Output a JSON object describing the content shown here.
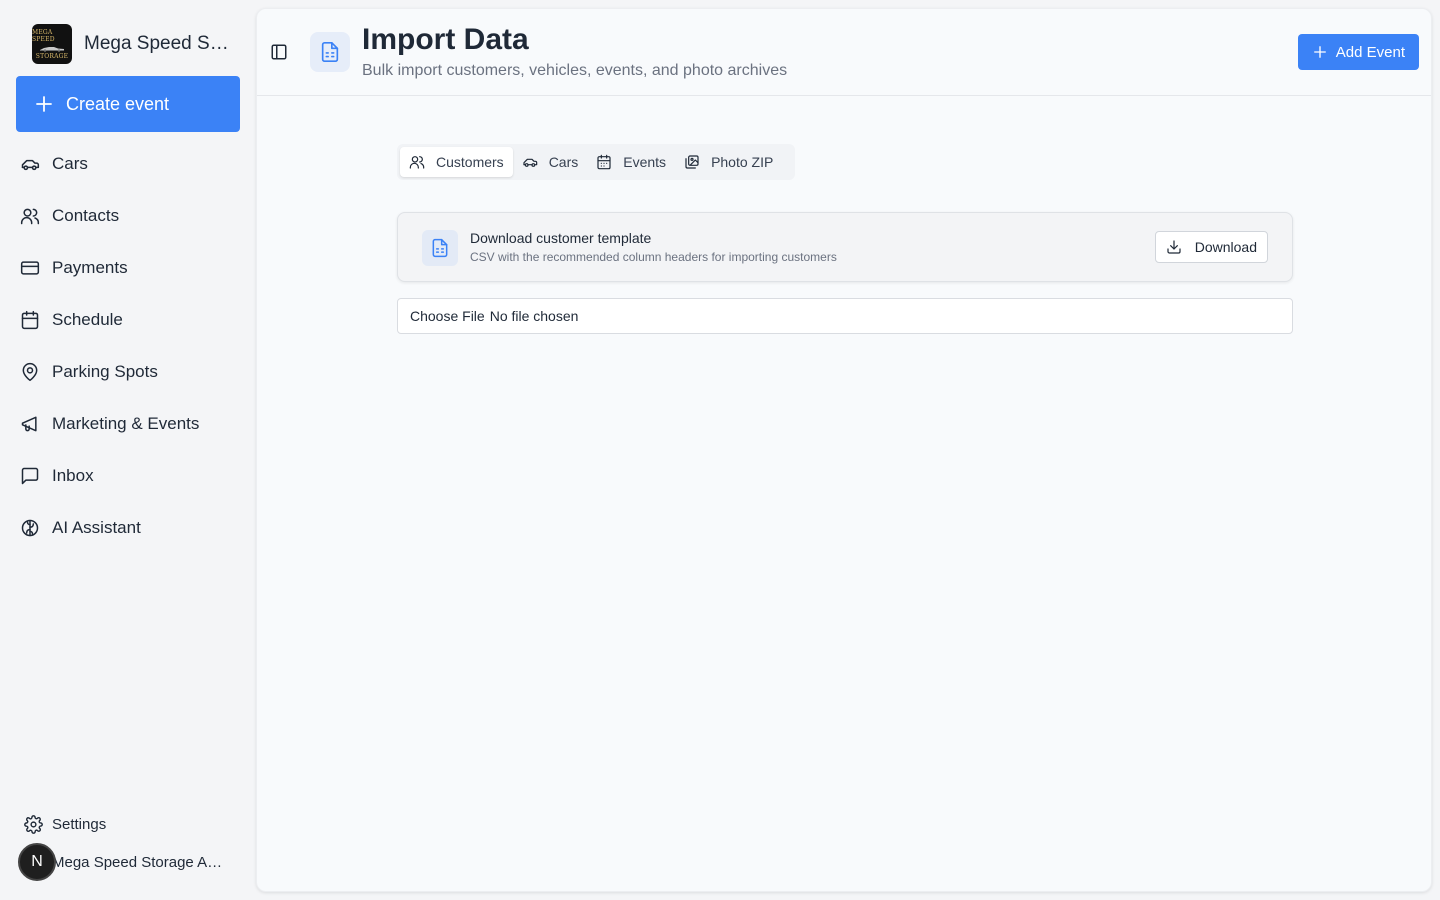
{
  "sidebar": {
    "brand": {
      "name": "Mega Speed Storage",
      "logo_top": "MEGA SPEED",
      "logo_bottom": "STORAGE"
    },
    "create_button": "Create event",
    "items": [
      {
        "label": "Cars",
        "icon": "car-icon"
      },
      {
        "label": "Contacts",
        "icon": "users-icon"
      },
      {
        "label": "Payments",
        "icon": "credit-card-icon"
      },
      {
        "label": "Schedule",
        "icon": "calendar-icon"
      },
      {
        "label": "Parking Spots",
        "icon": "map-pin-icon"
      },
      {
        "label": "Marketing & Events",
        "icon": "megaphone-icon"
      },
      {
        "label": "Inbox",
        "icon": "message-square-icon"
      },
      {
        "label": "AI Assistant",
        "icon": "brain-icon"
      }
    ],
    "settings": "Settings",
    "account": {
      "initial": "N",
      "name": "Mega Speed Storage Admin"
    }
  },
  "header": {
    "title": "Import Data",
    "subtitle": "Bulk import customers, vehicles, events, and photo archives",
    "add_event": "Add Event"
  },
  "tabs": [
    {
      "label": "Customers",
      "icon": "users-icon",
      "active": true
    },
    {
      "label": "Cars",
      "icon": "car-icon",
      "active": false
    },
    {
      "label": "Events",
      "icon": "calendar-icon",
      "active": false
    },
    {
      "label": "Photo ZIP",
      "icon": "images-icon",
      "active": false
    }
  ],
  "template_card": {
    "title": "Download customer template",
    "description": "CSV with the recommended column headers for importing customers",
    "download": "Download"
  },
  "file_input": {
    "button": "Choose File",
    "status": "No file chosen"
  },
  "colors": {
    "accent": "#3b82f6",
    "background": "#f4f5f7",
    "panel": "#f8fafc"
  }
}
